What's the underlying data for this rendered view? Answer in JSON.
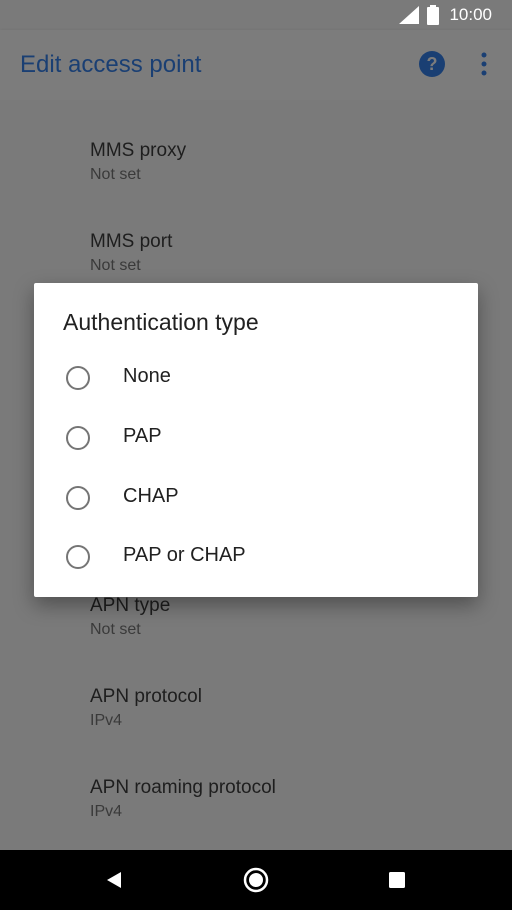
{
  "status_bar": {
    "time": "10:00",
    "icons": [
      "signal-icon",
      "battery-icon"
    ]
  },
  "app_bar": {
    "title": "Edit access point",
    "icons": [
      "help-icon",
      "more-vert-icon"
    ]
  },
  "preferences": [
    {
      "title": "MMS proxy",
      "summary": "Not set"
    },
    {
      "title": "MMS port",
      "summary": "Not set"
    },
    {
      "title": "APN type",
      "summary": "Not set"
    },
    {
      "title": "APN protocol",
      "summary": "IPv4"
    },
    {
      "title": "APN roaming protocol",
      "summary": "IPv4"
    }
  ],
  "dialog": {
    "title": "Authentication type",
    "options": [
      "None",
      "PAP",
      "CHAP",
      "PAP or CHAP"
    ]
  },
  "colors": {
    "accent": "#1a3f73",
    "scrim": "#7a7a7a"
  }
}
